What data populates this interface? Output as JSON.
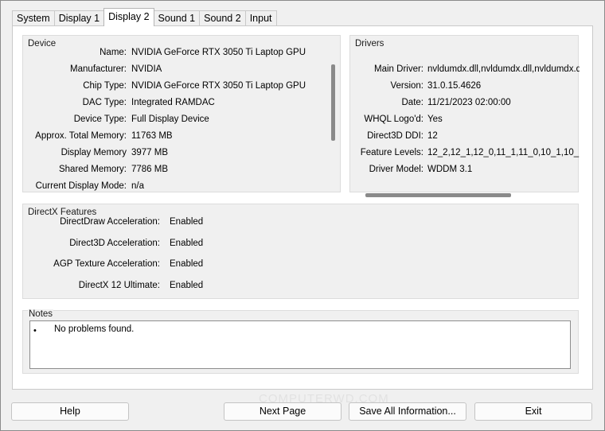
{
  "tabs": [
    "System",
    "Display 1",
    "Display 2",
    "Sound 1",
    "Sound 2",
    "Input"
  ],
  "active_tab": "Display 2",
  "device": {
    "title": "Device",
    "rows": [
      {
        "label": "Name:",
        "value": "NVIDIA GeForce RTX 3050 Ti Laptop GPU"
      },
      {
        "label": "Manufacturer:",
        "value": "NVIDIA"
      },
      {
        "label": "Chip Type:",
        "value": "NVIDIA GeForce RTX 3050 Ti Laptop GPU"
      },
      {
        "label": "DAC Type:",
        "value": "Integrated RAMDAC"
      },
      {
        "label": "Device Type:",
        "value": "Full Display Device"
      },
      {
        "label": "Approx. Total Memory:",
        "value": "11763 MB"
      },
      {
        "label": "Display Memory",
        "value": "3977 MB"
      },
      {
        "label": "Shared Memory:",
        "value": "7786 MB"
      },
      {
        "label": "Current Display Mode:",
        "value": "n/a"
      }
    ]
  },
  "drivers": {
    "title": "Drivers",
    "rows": [
      {
        "label": "Main Driver:",
        "value": "nvldumdx.dll,nvldumdx.dll,nvldumdx.d"
      },
      {
        "label": "Version:",
        "value": "31.0.15.4626"
      },
      {
        "label": "Date:",
        "value": "11/21/2023 02:00:00"
      },
      {
        "label": "WHQL Logo'd:",
        "value": "Yes"
      },
      {
        "label": "Direct3D DDI:",
        "value": "12"
      },
      {
        "label": "Feature Levels:",
        "value": "12_2,12_1,12_0,11_1,11_0,10_1,10_"
      },
      {
        "label": "Driver Model:",
        "value": "WDDM 3.1"
      }
    ]
  },
  "directx": {
    "title": "DirectX Features",
    "rows": [
      {
        "label": "DirectDraw Acceleration:",
        "value": "Enabled"
      },
      {
        "label": "Direct3D Acceleration:",
        "value": "Enabled"
      },
      {
        "label": "AGP Texture Acceleration:",
        "value": "Enabled"
      },
      {
        "label": "DirectX 12 Ultimate:",
        "value": "Enabled"
      }
    ]
  },
  "notes": {
    "title": "Notes",
    "bullet": "•",
    "text": "No problems found."
  },
  "buttons": {
    "help": "Help",
    "next_page": "Next Page",
    "save_all": "Save All Information...",
    "exit": "Exit"
  },
  "watermark": "COMPUTERWD.COM"
}
